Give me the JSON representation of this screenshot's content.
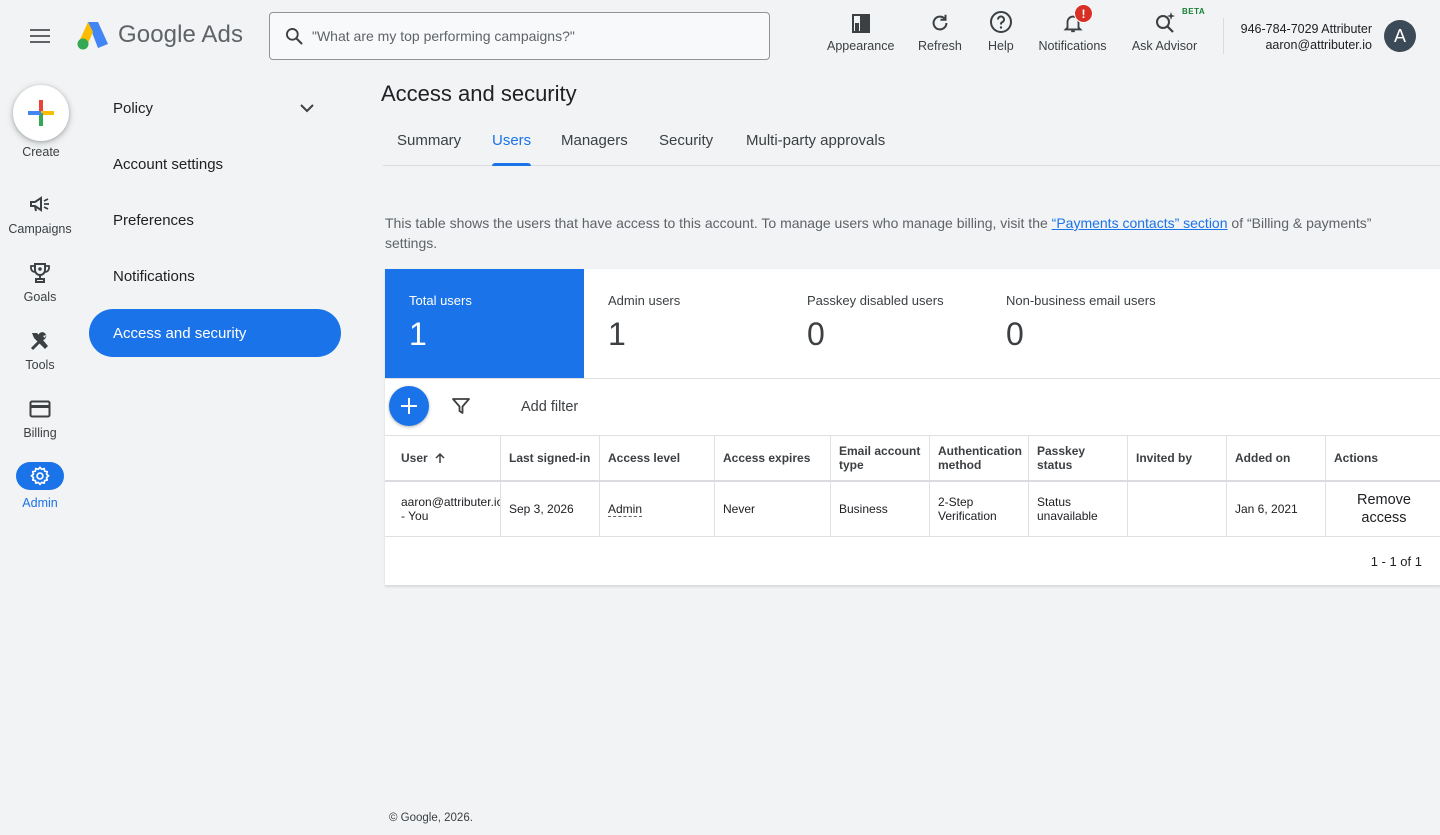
{
  "header": {
    "logo_text": "Google Ads",
    "search_placeholder": "\"What are my top performing campaigns?\"",
    "buttons": {
      "appearance": "Appearance",
      "refresh": "Refresh",
      "help": "Help",
      "notifications": "Notifications",
      "ask_advisor": "Ask Advisor"
    },
    "notifications_badge": "!",
    "beta_label": "BETA",
    "account_id": "946-784-7029 Attributer",
    "account_email": "aaron@attributer.io",
    "avatar_letter": "A"
  },
  "rail": {
    "create": "Create",
    "items": [
      "Campaigns",
      "Goals",
      "Tools",
      "Billing",
      "Admin"
    ]
  },
  "subnav": {
    "items": [
      "Policy",
      "Account settings",
      "Preferences",
      "Notifications",
      "Access and security"
    ]
  },
  "main": {
    "title": "Access and security",
    "tabs": [
      "Summary",
      "Users",
      "Managers",
      "Security",
      "Multi-party approvals"
    ],
    "description_before": "This table shows the users that have access to this account. To manage users who manage billing, visit the ",
    "description_link": "“Payments contacts” section",
    "description_after": " of “Billing & payments” settings.",
    "stats": [
      {
        "label": "Total users",
        "value": "1"
      },
      {
        "label": "Admin users",
        "value": "1"
      },
      {
        "label": "Passkey disabled users",
        "value": "0"
      },
      {
        "label": "Non-business email users",
        "value": "0"
      }
    ],
    "add_filter": "Add filter",
    "table": {
      "headers": [
        "User",
        "Last signed-in",
        "Access level",
        "Access expires",
        "Email account type",
        "Authentication method",
        "Passkey status",
        "Invited by",
        "Added on",
        "Actions"
      ],
      "row": {
        "user_email": "aaron@attributer.io",
        "user_suffix": "- You",
        "last_signed_in": "Sep 3, 2026",
        "access_level": "Admin",
        "access_expires": "Never",
        "email_type": "Business",
        "auth_method": "2-Step Verification",
        "passkey_status": "Status unavailable",
        "invited_by": "",
        "added_on": "Jan 6, 2021",
        "action": "Remove access"
      },
      "pagination": "1 - 1 of 1"
    }
  },
  "footer": "© Google, 2026.",
  "colors": {
    "accent": "#1a73e8",
    "badge": "#d93025",
    "avatar": "#3c4a57"
  }
}
